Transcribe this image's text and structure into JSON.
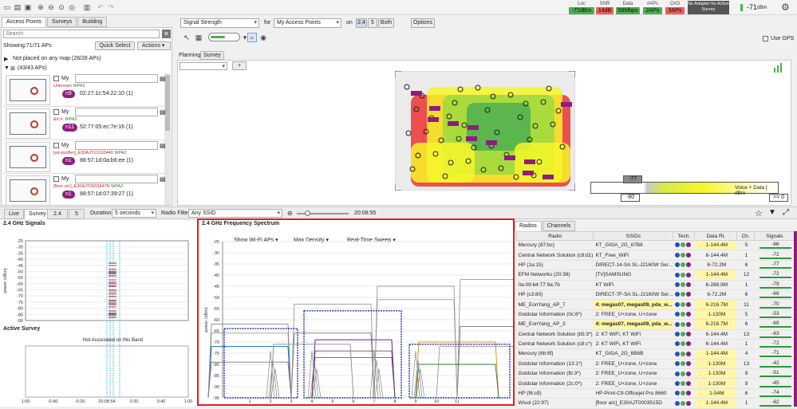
{
  "toolbar": {
    "stats": [
      {
        "label": "Loc",
        "value": "-72dBm",
        "color": "#2e9b3a"
      },
      {
        "label": "SNR",
        "value": "14dB",
        "color": "#e04848"
      },
      {
        "label": "Data",
        "value": "58Mbps",
        "color": "#2e9b3a"
      },
      {
        "label": "#APs",
        "value": "2APs",
        "color": "#2e9b3a"
      },
      {
        "label": "ChO",
        "value": "3APs",
        "color": "#e04848"
      }
    ],
    "adapter_note": "No Adapter for Active Survey",
    "signal_readout": "-71",
    "signal_unit": "dBm"
  },
  "left_tabs": [
    "Access Points",
    "Surveys",
    "Building"
  ],
  "search": {
    "placeholder": "Search"
  },
  "showing": "Showing:71/71 APs",
  "quick_select": "Quick Select",
  "actions": "Actions",
  "group_unplaced": "Not placed on any map (28/28 APs)",
  "group_placed": "(43/43 APs)",
  "ap_list": [
    {
      "name": "Unknown",
      "tag": "WPA2",
      "my": "My",
      "badge": "n9",
      "mac": "02:27:1c:54:22:10 (1)"
    },
    {
      "name": "&#;#;",
      "tag": "WPA2",
      "my": "My",
      "badge": "n11",
      "mac": "52:77:05:ec:7e:16 (1)"
    },
    {
      "name": "[air-purifier]_E30AJT10133440",
      "tag": "WPA2",
      "my": "My",
      "badge": "n1",
      "mac": "88:57:1d:0a:b6:ee (1)"
    },
    {
      "name": "[floor a/c]_E30AJT0003847N",
      "tag": "WPA2",
      "my": "My",
      "badge": "n1",
      "mac": "88:57:1d:07:39:27 (1)"
    }
  ],
  "map_controls": {
    "viz": "Signal Strength",
    "for_label": "for",
    "for_value": "My Access Points",
    "on_label": "on",
    "bands": [
      "2.4",
      "5",
      "Both"
    ],
    "options": "Options",
    "use_gps": "Use GPS",
    "sub_tabs": [
      "Planning",
      "Survey"
    ]
  },
  "legend": {
    "value_top": "-77",
    "value_bottom": "-80",
    "label": "Voice + Data [ dBm",
    "threshold": ">= 0"
  },
  "bottom_bar": {
    "tabs": [
      "Live",
      "Survey",
      "2.4",
      "5"
    ],
    "duration_label": "Duration",
    "duration_value": "5 seconds",
    "filter_label": "Radio Filter",
    "filter_value": "Any SSID",
    "time": "20:08:55"
  },
  "signals_chart": {
    "title": "2.4 GHz Signals",
    "ylabel": "power (dBm)",
    "yticks": [
      "-25",
      "-30",
      "-35",
      "-40",
      "-45",
      "-50",
      "-55",
      "-60",
      "-65",
      "-70",
      "-75",
      "-80",
      "-85",
      "-90"
    ],
    "xticks": [
      "1:00",
      "-0:40",
      "-0:20",
      "20:08:54",
      "0:20",
      "0:40",
      "1:00"
    ],
    "xlabel": "time"
  },
  "active_survey": {
    "title": "Active Survey",
    "message": "Not Associated on this Band"
  },
  "spectrum": {
    "title": "2.4 GHz Frequency Spectrum",
    "dropdowns": [
      "Show Wi-Fi APs",
      "Max Density",
      "Real-Time Sweep"
    ],
    "ylabel": "power (dBm)",
    "yticks": [
      "-25",
      "-30",
      "-35",
      "-40",
      "-45",
      "-50",
      "-55",
      "-60",
      "-65",
      "-70",
      "-75",
      "-80",
      "-85",
      "-90",
      "-95"
    ],
    "xticks": [
      "1",
      "2",
      "3",
      "4",
      "5",
      "6",
      "7",
      "8",
      "9",
      "10",
      "11"
    ]
  },
  "right_tabs": [
    "Radios",
    "Channels"
  ],
  "radio_table": {
    "headers": [
      "Radio",
      "SSIDs",
      "Tech.",
      "Data Rt.",
      "Ch.",
      "Signals"
    ],
    "rows": [
      {
        "radio": "Mercury (87:bc)",
        "ssid": "KT_GIGA_2G_87B8",
        "rate": "1-144.4M",
        "hl": true,
        "ch": "5",
        "sig": "-66"
      },
      {
        "radio": "Central Network Solution (c8:d1)",
        "ssid": "KT_Free_WiFi",
        "rate": "6-144.4M",
        "hl": false,
        "ch": "1",
        "sig": "-72"
      },
      {
        "radio": "HP (1a:15)",
        "ssid": "DIRECT-14-SA SL-J2160W Ser...",
        "rate": "6-72.2M",
        "hl": false,
        "ch": "6",
        "sig": "-77"
      },
      {
        "radio": "EFM Networks (20:38)",
        "ssid": "[TV]SAMSUNG",
        "rate": "1-144.4M",
        "hl": true,
        "ch": "12",
        "sig": "-72"
      },
      {
        "radio": "0a:09:b4:77:9a:7b",
        "ssid": "KT WiFi",
        "rate": "6-288.9M",
        "hl": false,
        "ch": "1",
        "sig": "-79"
      },
      {
        "radio": "HP (c3:80)",
        "ssid": "DIRECT-7F-SA SL-J2160W Ser...",
        "rate": "6-72.2M",
        "hl": false,
        "ch": "6",
        "sig": "-69"
      },
      {
        "radio": "ME_EonYang_AP_7",
        "ssid": "4: megas07, megas09, pda_w...",
        "rate": "6-216.7M",
        "hl": true,
        "ch": "11",
        "sig": "-70"
      },
      {
        "radio": "Goldstar Information (0c:6*)",
        "ssid": "2: FREE_U+zone, U+zone",
        "rate": "1-130M",
        "hl": true,
        "ch": "5",
        "sig": "-53"
      },
      {
        "radio": "ME_EonYang_AP_3",
        "ssid": "4: megas07, megas09, pda_w...",
        "rate": "6-216.7M",
        "hl": true,
        "ch": "6",
        "sig": "-69"
      },
      {
        "radio": "Central Network Solution (b5:3*)",
        "ssid": "2: KT WiFi, KT WiFi",
        "rate": "6-144.4M",
        "hl": false,
        "ch": "13",
        "sig": "-63"
      },
      {
        "radio": "Central Network Solution (c8:c*)",
        "ssid": "2: KT WiFi, KT WiFi",
        "rate": "6-144.4M",
        "hl": false,
        "ch": "1",
        "sig": "-72"
      },
      {
        "radio": "Mercury (6b:6f)",
        "ssid": "KT_GIGA_2G_6B6B",
        "rate": "1-144.4M",
        "hl": true,
        "ch": "4",
        "sig": "-71"
      },
      {
        "radio": "Goldstar Information (13:1*)",
        "ssid": "2: FREE_U+zone, U+zone",
        "rate": "1-130M",
        "hl": true,
        "ch": "13",
        "sig": "-42"
      },
      {
        "radio": "Goldstar Information (fb:3*)",
        "ssid": "2: FREE_U+zone, U+zone",
        "rate": "1-130M",
        "hl": true,
        "ch": "9",
        "sig": "-51"
      },
      {
        "radio": "Goldstar Information (2c:0*)",
        "ssid": "2: FREE_U+zone, U+zone",
        "rate": "1-130M",
        "hl": true,
        "ch": "9",
        "sig": "-45"
      },
      {
        "radio": "HP (f6:c9)",
        "ssid": "HP-Print-C9-Officejet Pro 8660",
        "rate": "1-54M",
        "hl": true,
        "ch": "6",
        "sig": "-74"
      },
      {
        "radio": "Wisol (22:97)",
        "ssid": "[floor a/c]_E30AJT0003515D",
        "rate": "1-144.4M",
        "hl": true,
        "ch": "1",
        "sig": "-62"
      }
    ]
  }
}
